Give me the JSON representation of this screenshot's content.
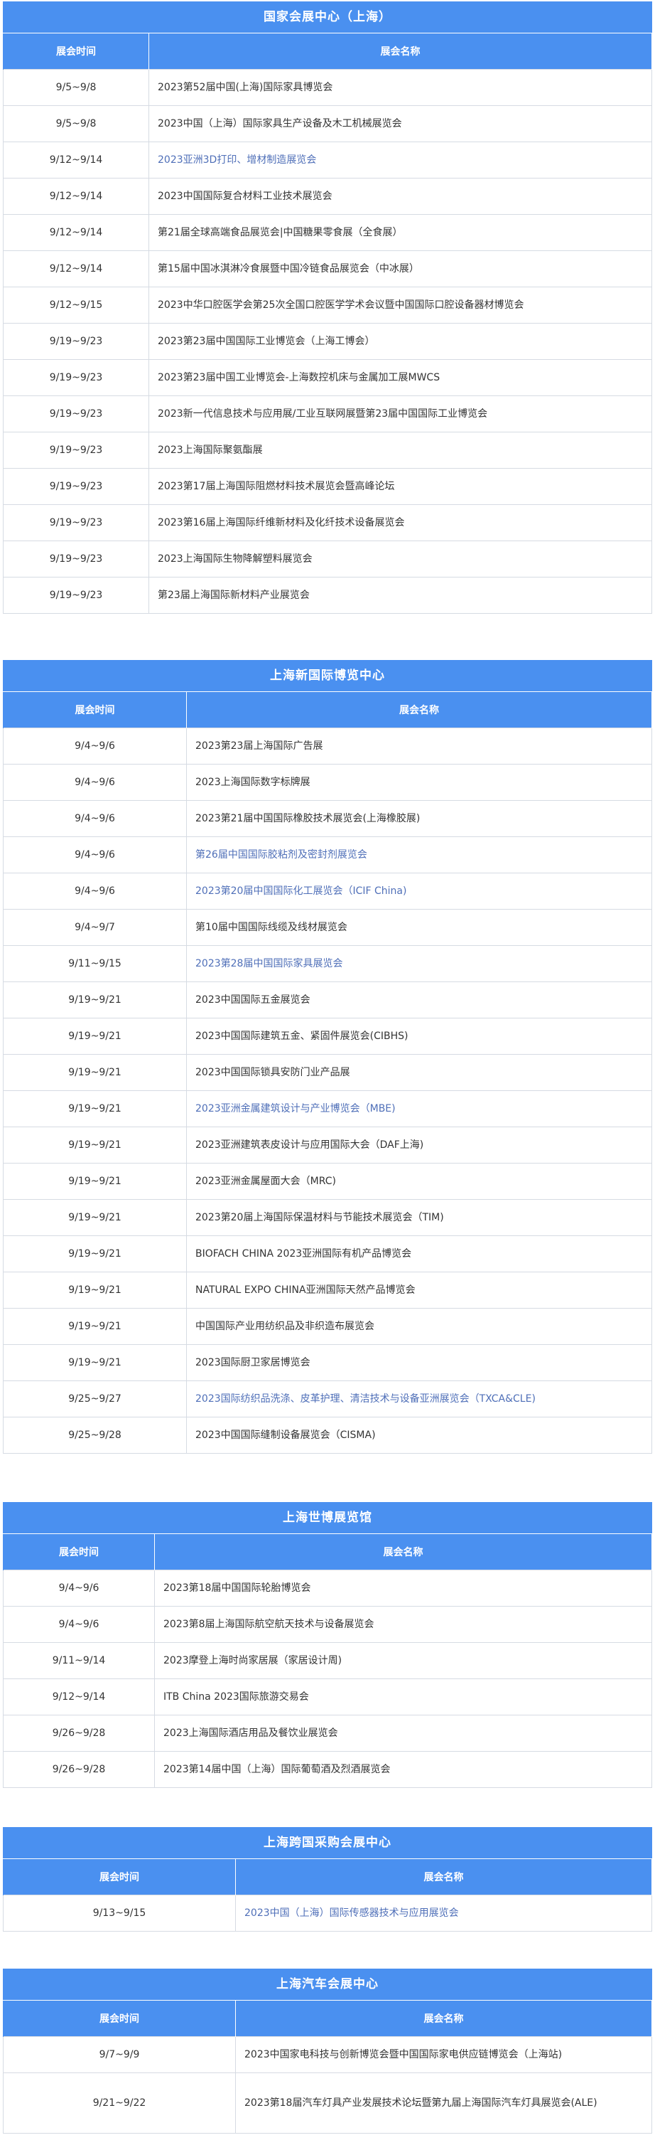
{
  "columns": {
    "time": "展会时间",
    "name": "展会名称"
  },
  "venues": [
    {
      "title": "国家会展中心（上海）",
      "rows": [
        {
          "time": "9/5~9/8",
          "name": "2023第52届中国(上海)国际家具博览会",
          "link": false
        },
        {
          "time": "9/5~9/8",
          "name": "2023中国（上海）国际家具生产设备及木工机械展览会",
          "link": false
        },
        {
          "time": "9/12~9/14",
          "name": "2023亚洲3D打印、增材制造展览会",
          "link": true
        },
        {
          "time": "9/12~9/14",
          "name": "2023中国国际复合材料工业技术展览会",
          "link": false
        },
        {
          "time": "9/12~9/14",
          "name": "第21届全球高端食品展览会|中国糖果零食展（全食展）",
          "link": false
        },
        {
          "time": "9/12~9/14",
          "name": "第15届中国冰淇淋冷食展暨中国冷链食品展览会（中冰展）",
          "link": false
        },
        {
          "time": "9/12~9/15",
          "name": "2023中华口腔医学会第25次全国口腔医学学术会议暨中国国际口腔设备器材博览会",
          "link": false
        },
        {
          "time": "9/19~9/23",
          "name": "2023第23届中国国际工业博览会（上海工博会）",
          "link": false
        },
        {
          "time": "9/19~9/23",
          "name": "2023第23届中国工业博览会-上海数控机床与金属加工展MWCS",
          "link": false
        },
        {
          "time": "9/19~9/23",
          "name": "2023新一代信息技术与应用展/工业互联网展暨第23届中国国际工业博览会",
          "link": false
        },
        {
          "time": "9/19~9/23",
          "name": "2023上海国际聚氨酯展",
          "link": false
        },
        {
          "time": "9/19~9/23",
          "name": "2023第17届上海国际阻燃材料技术展览会暨高峰论坛",
          "link": false
        },
        {
          "time": "9/19~9/23",
          "name": "2023第16届上海国际纤维新材料及化纤技术设备展览会",
          "link": false
        },
        {
          "time": "9/19~9/23",
          "name": "2023上海国际生物降解塑料展览会",
          "link": false
        },
        {
          "time": "9/19~9/23",
          "name": "第23届上海国际新材料产业展览会",
          "link": false
        }
      ]
    },
    {
      "title": "上海新国际博览中心",
      "rows": [
        {
          "time": "9/4~9/6",
          "name": "2023第23届上海国际广告展",
          "link": false
        },
        {
          "time": "9/4~9/6",
          "name": "2023上海国际数字标牌展",
          "link": false
        },
        {
          "time": "9/4~9/6",
          "name": "2023第21届中国国际橡胶技术展览会(上海橡胶展)",
          "link": false
        },
        {
          "time": "9/4~9/6",
          "name": "第26届中国国际胶粘剂及密封剂展览会",
          "link": true
        },
        {
          "time": "9/4~9/6",
          "name": "2023第20届中国国际化工展览会（ICIF China)",
          "link": true
        },
        {
          "time": "9/4~9/7",
          "name": "第10届中国国际线缆及线材展览会",
          "link": false
        },
        {
          "time": "9/11~9/15",
          "name": "2023第28届中国国际家具展览会",
          "link": true
        },
        {
          "time": "9/19~9/21",
          "name": "2023中国国际五金展览会",
          "link": false
        },
        {
          "time": "9/19~9/21",
          "name": "2023中国国际建筑五金、紧固件展览会(CIBHS)",
          "link": false
        },
        {
          "time": "9/19~9/21",
          "name": "2023中国国际锁具安防门业产品展",
          "link": false
        },
        {
          "time": "9/19~9/21",
          "name": "2023亚洲金属建筑设计与产业博览会（MBE)",
          "link": true
        },
        {
          "time": "9/19~9/21",
          "name": "2023亚洲建筑表皮设计与应用国际大会（DAF上海)",
          "link": false
        },
        {
          "time": "9/19~9/21",
          "name": "2023亚洲金属屋面大会（MRC)",
          "link": false
        },
        {
          "time": "9/19~9/21",
          "name": "2023第20届上海国际保温材料与节能技术展览会（TIM)",
          "link": false
        },
        {
          "time": "9/19~9/21",
          "name": "BIOFACH CHINA 2023亚洲国际有机产品博览会",
          "link": false
        },
        {
          "time": "9/19~9/21",
          "name": "NATURAL EXPO CHINA亚洲国际天然产品博览会",
          "link": false
        },
        {
          "time": "9/19~9/21",
          "name": "中国国际产业用纺织品及非织造布展览会",
          "link": false
        },
        {
          "time": "9/19~9/21",
          "name": "2023国际厨卫家居博览会",
          "link": false
        },
        {
          "time": "9/25~9/27",
          "name": "2023国际纺织品洗涤、皮革护理、清洁技术与设备亚洲展览会（TXCA&CLE)",
          "link": true
        },
        {
          "time": "9/25~9/28",
          "name": "2023中国国际缝制设备展览会（CISMA)",
          "link": false
        }
      ]
    },
    {
      "title": "上海世博展览馆",
      "rows": [
        {
          "time": "9/4~9/6",
          "name": "2023第18届中国国际轮胎博览会",
          "link": false
        },
        {
          "time": "9/4~9/6",
          "name": "2023第8届上海国际航空航天技术与设备展览会",
          "link": false
        },
        {
          "time": "9/11~9/14",
          "name": "2023摩登上海时尚家居展（家居设计周)",
          "link": false
        },
        {
          "time": "9/12~9/14",
          "name": "ITB China 2023国际旅游交易会",
          "link": false
        },
        {
          "time": "9/26~9/28",
          "name": "2023上海国际酒店用品及餐饮业展览会",
          "link": false
        },
        {
          "time": "9/26~9/28",
          "name": "2023第14届中国（上海）国际葡萄酒及烈酒展览会",
          "link": false
        }
      ]
    },
    {
      "title": "上海跨国采购会展中心",
      "rows": [
        {
          "time": "9/13~9/15",
          "name": "2023中国（上海）国际传感器技术与应用展览会",
          "link": true
        }
      ]
    },
    {
      "title": "上海汽车会展中心",
      "rows": [
        {
          "time": "9/7~9/9",
          "name": "2023中国家电科技与创新博览会暨中国国际家电供应链博览会（上海站)",
          "link": false
        },
        {
          "time": "9/21~9/22",
          "name": "2023第18届汽车灯具产业发展技术论坛暨第九届上海国际汽车灯具展览会(ALE)",
          "link": false
        }
      ]
    }
  ]
}
